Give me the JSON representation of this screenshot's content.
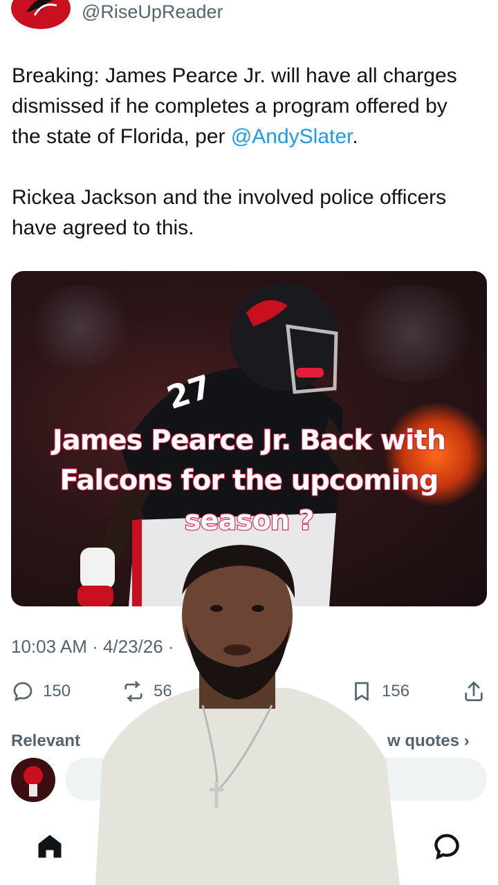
{
  "tweet": {
    "handle": "@RiseUpReader",
    "text_line1": "Breaking: James Pearce Jr. will have all charges",
    "text_line2": "dismissed if he completes a program offered by",
    "text_line3_prefix": "the state of Florida, per ",
    "mention": "@AndySlater",
    "text_line3_suffix": ".",
    "text_line4": "Rickea Jackson and the involved police officers",
    "text_line5": "have agreed to this.",
    "timestamp": "10:03 AM · 4/23/26 ·"
  },
  "overlay_caption": {
    "line1": "James Pearce Jr. Back with",
    "line2": "Falcons for the upcoming",
    "line3": "season ?"
  },
  "actions": {
    "replies": "150",
    "reposts": "56",
    "bookmarks": "156"
  },
  "sections": {
    "relevant": "Relevant",
    "quotes": "w quotes ›"
  },
  "colors": {
    "accent": "#1d9bf0",
    "caption_stroke": "#d61a3c",
    "falcons_red": "#c8101e"
  },
  "icons": [
    "reply-icon",
    "repost-icon",
    "bookmark-icon",
    "share-icon",
    "home-icon",
    "messages-icon"
  ]
}
